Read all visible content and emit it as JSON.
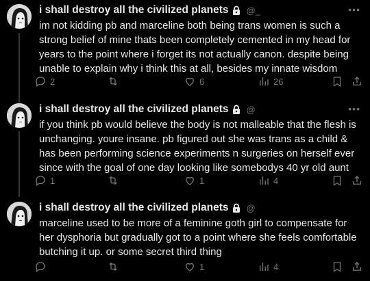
{
  "tweets": [
    {
      "display_name": "i shall destroy all the civilized planets",
      "handle": "@_",
      "text": "im not kidding pb and marceline both being trans women is such a strong belief of mine thats been completely cemented in my head for years to the point where i forget its not actually canon. despite being unable to explain why i think this at all, besides my innate wisdom",
      "replies": "2",
      "retweets": "",
      "likes": "6",
      "views": "26"
    },
    {
      "display_name": "i shall destroy all the civilized planets",
      "handle": "@",
      "text": "if you think pb would believe the body is not malleable that the flesh is unchanging. youre insane. pb figured out she was trans as a child & has been performing science experiments n surgeries on herself ever since with the goal of one day looking like somebodys 40 yr old aunt",
      "replies": "1",
      "retweets": "",
      "likes": "1",
      "views": "4"
    },
    {
      "display_name": "i shall destroy all the civilized planets",
      "handle": "@",
      "text": "marceline used to be more of a feminine goth girl to compensate for her dysphoria but gradually got to a point where she feels comfortable butching it up. or some secret third thing",
      "replies": "",
      "retweets": "",
      "likes": "1",
      "views": "4"
    }
  ],
  "more_label": "•••",
  "colors": {
    "background": "#000000",
    "text": "#e7e9ea",
    "muted": "#71767b",
    "thread_line": "#333639"
  },
  "icons": [
    "reply-icon",
    "retweet-icon",
    "like-icon",
    "views-icon",
    "bookmark-icon",
    "share-icon",
    "lock-icon"
  ]
}
